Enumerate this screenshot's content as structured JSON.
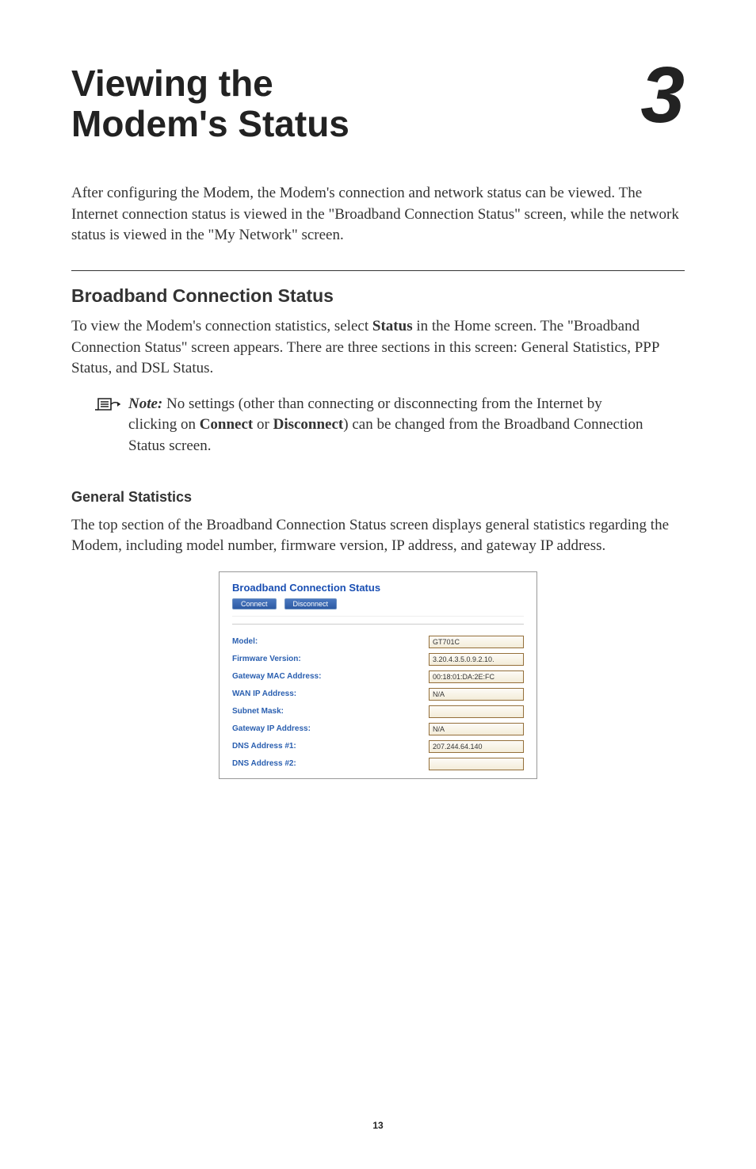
{
  "title_line1": "Viewing the",
  "title_line2": "Modem's Status",
  "chapter_number": "3",
  "intro": "After configuring the Modem, the Modem's connection and network status can be viewed. The Internet connection status is viewed in the \"Broadband Connection Status\" screen, while the network status is viewed in the \"My Network\" screen.",
  "section1": {
    "heading": "Broadband Connection Status",
    "para_parts": {
      "a": "To view the Modem's connection statistics, select ",
      "b": "Status",
      "c": " in the Home screen. The \"Broadband Connection Status\" screen appears.  There are three sections in this screen: General Statistics, PPP Status, and DSL Status."
    },
    "note": {
      "label": "Note:",
      "a": " No settings (other than connecting or disconnecting from the Internet by clicking on ",
      "b": "Connect",
      "c": " or ",
      "d": "Disconnect",
      "e": ") can be changed from the Broadband Connection Status screen."
    }
  },
  "section2": {
    "heading": "General Statistics",
    "para": "The top section of the Broadband Connection Status screen displays general statistics regarding the Modem, including model number, firmware version, IP address, and gateway IP address."
  },
  "panel": {
    "title": "Broadband Connection Status",
    "connect": "Connect",
    "disconnect": "Disconnect",
    "rows": [
      {
        "label": "Model:",
        "value": "GT701C"
      },
      {
        "label": "Firmware Version:",
        "value": "3.20.4.3.5.0.9.2.10."
      },
      {
        "label": "Gateway MAC Address:",
        "value": "00:18:01:DA:2E:FC"
      },
      {
        "label": "WAN IP Address:",
        "value": "N/A"
      },
      {
        "label": "Subnet Mask:",
        "value": ""
      },
      {
        "label": "Gateway IP Address:",
        "value": "N/A"
      },
      {
        "label": "DNS Address #1:",
        "value": "207.244.64.140"
      },
      {
        "label": "DNS Address #2:",
        "value": ""
      }
    ]
  },
  "page_number": "13"
}
